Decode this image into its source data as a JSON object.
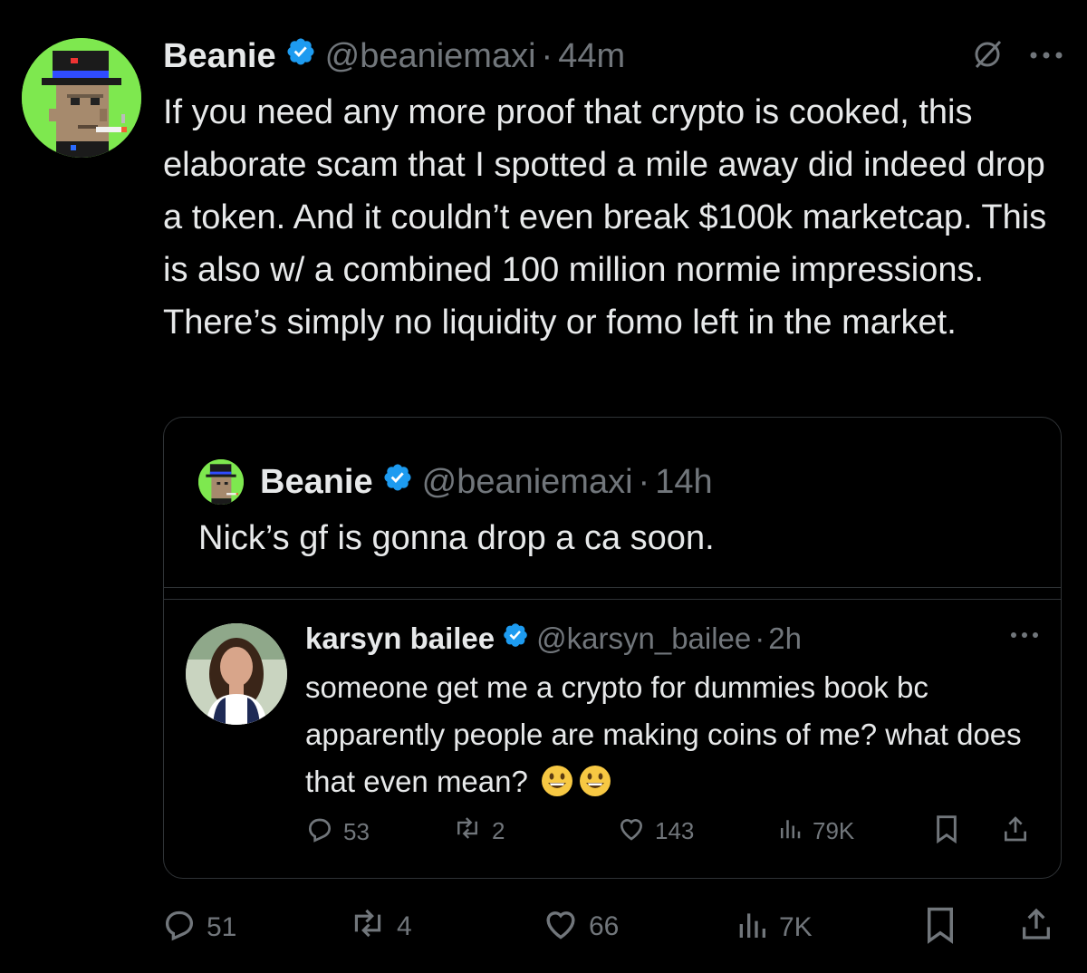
{
  "tweet": {
    "author_name": "Beanie",
    "handle": "@beaniemaxi",
    "separator": "·",
    "time": "44m",
    "text": "If you need any more proof that crypto is cooked, this elaborate scam that I spotted a mile away did indeed drop a token. And it couldn’t even break $100k marketcap. This is also w/ a combined 100 million normie impressions. There’s simply no liquidity or fomo left in the market.",
    "stats": {
      "replies": "51",
      "reposts": "4",
      "likes": "66",
      "views": "7K"
    }
  },
  "quoted": {
    "author_name": "Beanie",
    "handle": "@beaniemaxi",
    "separator": "·",
    "time": "14h",
    "text": "Nick’s gf is gonna drop a ca soon."
  },
  "nested": {
    "author_name": "karsyn bailee",
    "handle": "@karsyn_bailee",
    "separator": "·",
    "time": "2h",
    "text": "someone get me a crypto for dummies book bc apparently people are making coins of me? what does that even mean?",
    "stats": {
      "replies": "53",
      "reposts": "2",
      "likes": "143",
      "views": "79K"
    }
  },
  "colors": {
    "background": "#000000",
    "text": "#e7e9ea",
    "muted": "#71767b",
    "verified": "#1d9bf0",
    "border": "#2f3336",
    "avatar_bg": "#7ee84f"
  },
  "icons": [
    "verified-badge-icon",
    "grok-icon",
    "more-icon",
    "reply-icon",
    "repost-icon",
    "like-icon",
    "views-icon",
    "bookmark-icon",
    "share-icon",
    "grinning-emoji-icon"
  ]
}
